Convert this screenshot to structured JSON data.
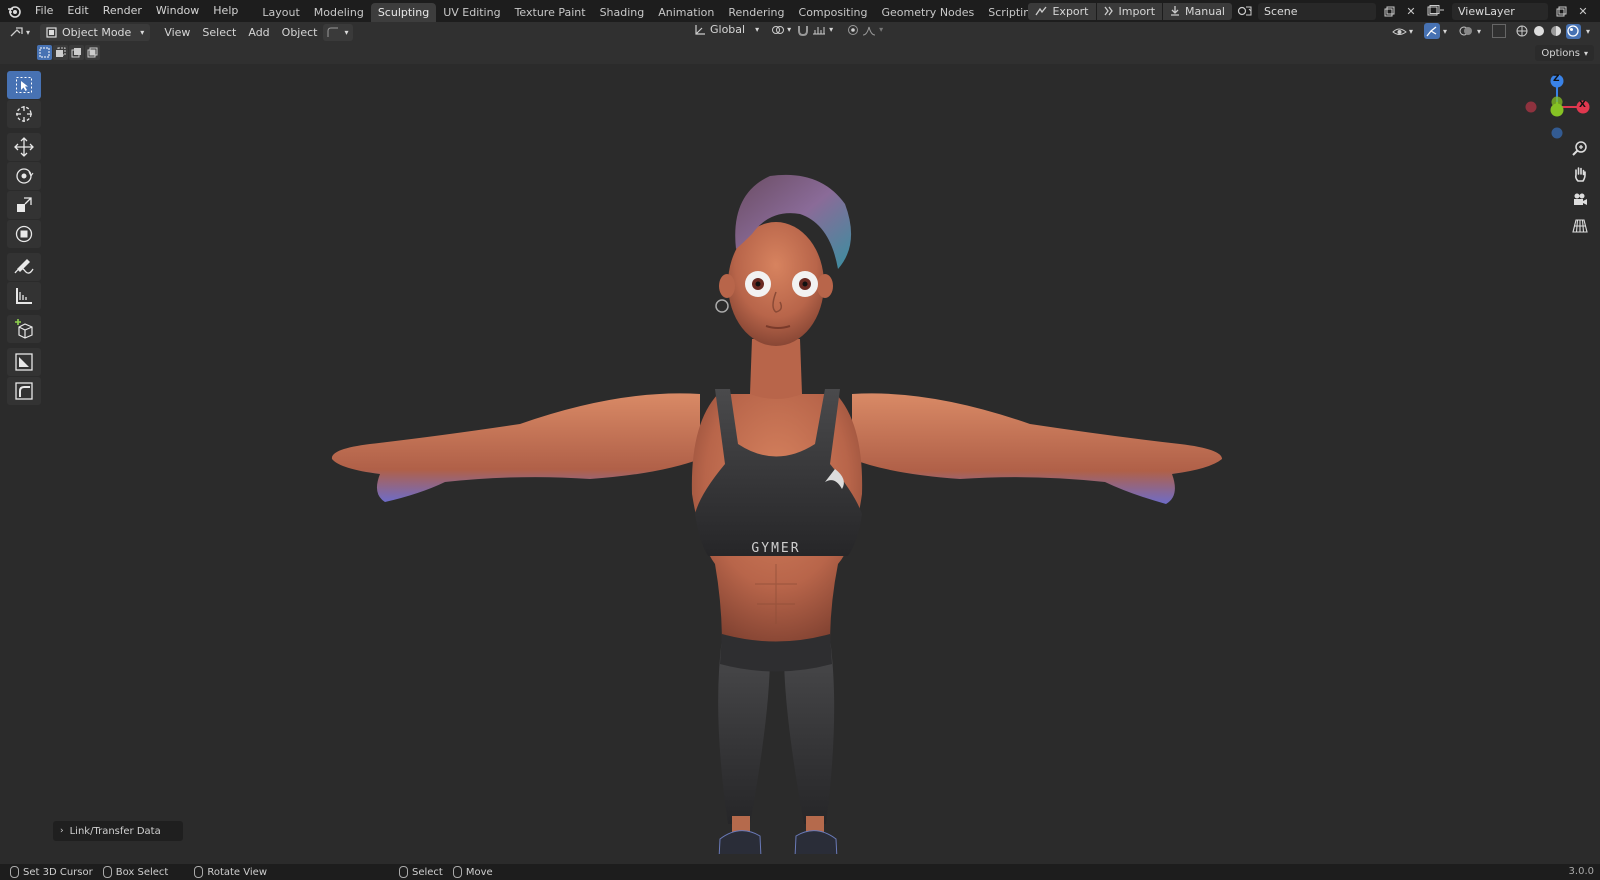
{
  "topbar": {
    "menus": [
      "File",
      "Edit",
      "Render",
      "Window",
      "Help"
    ],
    "workspaces": [
      "Layout",
      "Modeling",
      "Sculpting",
      "UV Editing",
      "Texture Paint",
      "Shading",
      "Animation",
      "Rendering",
      "Compositing",
      "Geometry Nodes",
      "Scripting"
    ],
    "active_workspace": "Sculpting",
    "export_label": "Export",
    "import_label": "Import",
    "manual_label": "Manual",
    "scene_value": "Scene",
    "view_layer_value": "ViewLayer"
  },
  "header": {
    "mode": "Object Mode",
    "menus": [
      "View",
      "Select",
      "Add",
      "Object"
    ],
    "transform_orientation": "Global"
  },
  "toolrow": {
    "options_label": "Options"
  },
  "viewport": {
    "gizmo_axes": {
      "z": "Z",
      "x": "X"
    },
    "garment_text": "GYMER",
    "redo_panel_label": "Link/Transfer Data"
  },
  "statusbar": {
    "items": [
      "Set 3D Cursor",
      "Box Select",
      "Rotate View",
      "Select",
      "Move"
    ],
    "version": "3.0.0"
  },
  "colors": {
    "accent": "#4772b3",
    "axis_x": "#e0384f",
    "axis_y": "#86c224",
    "axis_z": "#3a83e8",
    "background": "#2b2b2b"
  }
}
